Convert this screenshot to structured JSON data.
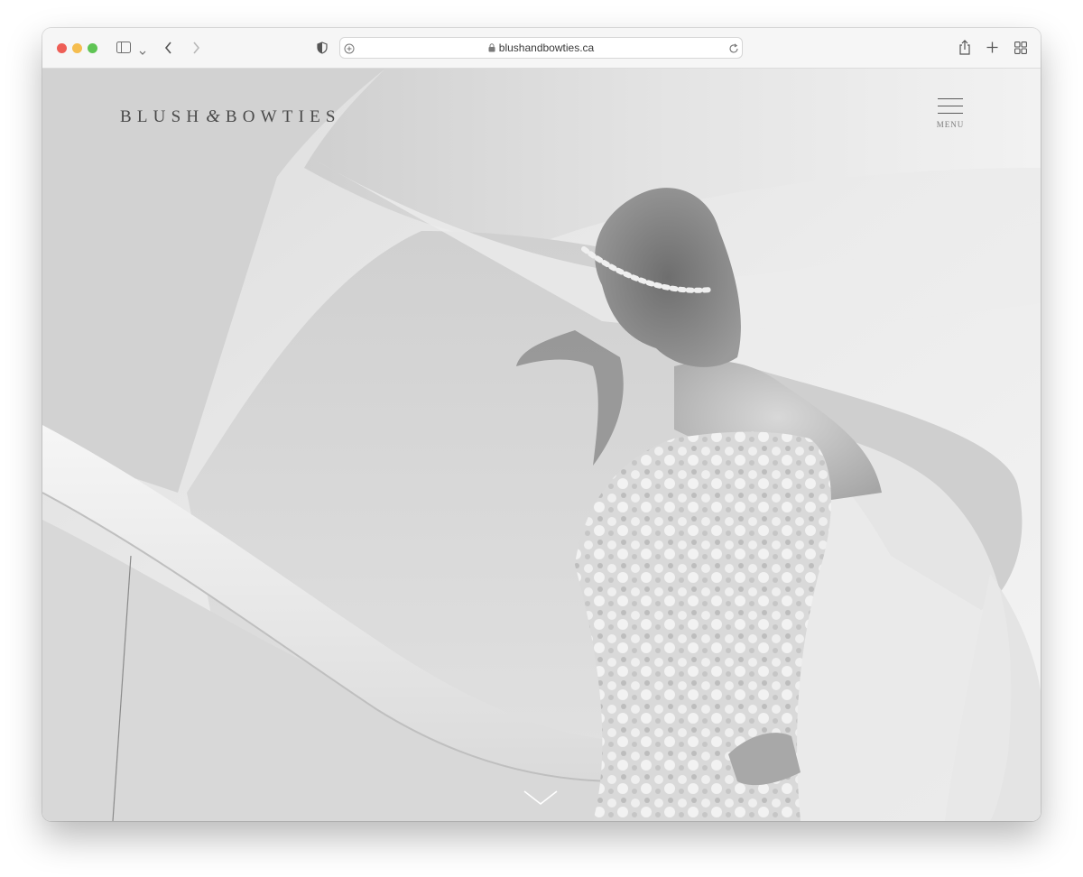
{
  "browser": {
    "url": "blushandbowties.ca"
  },
  "site": {
    "logo_left": "BLUSH",
    "logo_amp": "&",
    "logo_right": "BOWTIES",
    "menu_label": "MENU"
  },
  "colors": {
    "close": "#ee5e56",
    "minimize": "#f5bd4f",
    "zoom": "#5fc454"
  },
  "icons": {
    "sidebar": "sidebar-icon",
    "back": "chevron-left-icon",
    "forward": "chevron-right-icon",
    "shield": "shield-icon",
    "lock": "lock-icon",
    "reload": "reload-icon",
    "share": "share-icon",
    "new_tab": "plus-icon",
    "tabs": "tab-overview-icon",
    "scroll": "chevron-down-icon"
  }
}
